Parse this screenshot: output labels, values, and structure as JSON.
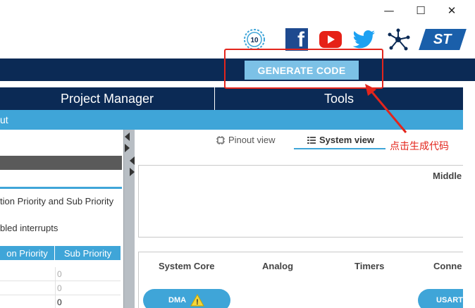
{
  "window": {
    "minimize_glyph": "—",
    "maximize_glyph": "☐",
    "close_glyph": "✕"
  },
  "toolbar": {
    "icons": [
      "anniversary-10-icon",
      "facebook-icon",
      "youtube-icon",
      "twitter-icon",
      "network-icon",
      "st-logo"
    ],
    "badge_text": "10",
    "facebook_glyph": "f",
    "st_logo_text": "ST",
    "generate_label": "GENERATE CODE"
  },
  "annotation": {
    "text": "点击生成代码",
    "color": "#e3251c"
  },
  "main_tabs": {
    "project_manager": "Project Manager",
    "tools": "Tools"
  },
  "sub_band": {
    "label": "ut"
  },
  "left_panel": {
    "priority_option": "tion Priority and Sub Priority",
    "enabled_interrupts": "bled interrupts",
    "columns": [
      "on Priority",
      "Sub Priority"
    ],
    "rows": [
      "0",
      "0",
      "0"
    ]
  },
  "right_panel": {
    "pinout_view": "Pinout view",
    "system_view": "System view",
    "middle_label": "Middle",
    "categories": [
      "System Core",
      "Analog",
      "Timers",
      "Conne"
    ],
    "dma_label": "DMA",
    "usart_label": "USART",
    "warning_glyph": "!"
  },
  "colors": {
    "navy": "#0b2a55",
    "accent_blue": "#3fa5d8",
    "generate_button": "#7cc1e6"
  }
}
